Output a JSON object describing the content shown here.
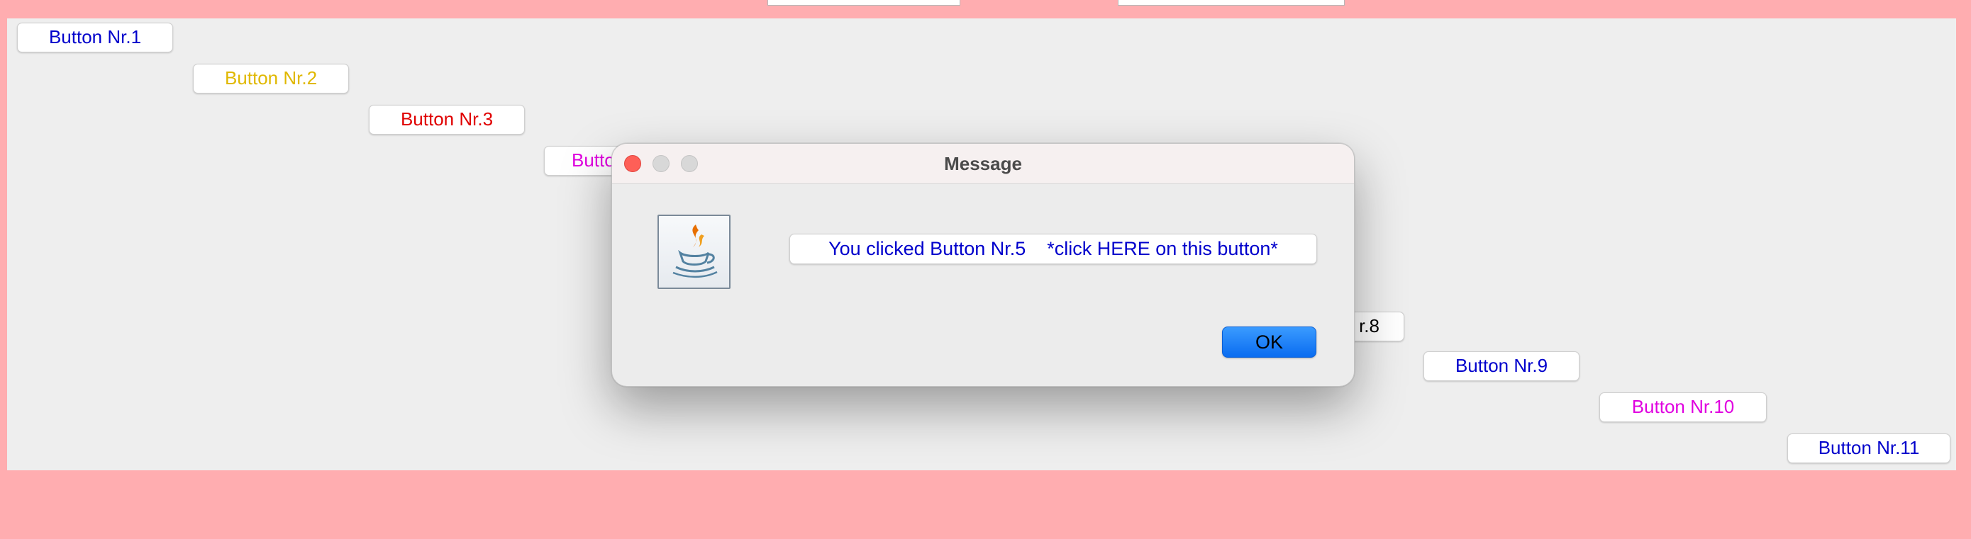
{
  "colors": {
    "background": "#ffadb0",
    "panel": "#eeeeee",
    "blue_text": "#0000cc",
    "yellow_text": "#e0b800",
    "red_text": "#e00000",
    "magenta_text": "#e000e0",
    "ok_button": "#0a6cf0"
  },
  "buttons": [
    {
      "label": "Button Nr.1",
      "color": "#0000cc"
    },
    {
      "label": "Button Nr.2",
      "color": "#e0b800"
    },
    {
      "label": "Button Nr.3",
      "color": "#e00000"
    },
    {
      "label": "Butto",
      "color": "#e000e0"
    },
    {
      "label": "r.8",
      "color": "#000000"
    },
    {
      "label": "Button Nr.9",
      "color": "#0000cc"
    },
    {
      "label": "Button Nr.10",
      "color": "#e000e0"
    },
    {
      "label": "Button Nr.11",
      "color": "#0000cc"
    }
  ],
  "dialog": {
    "title": "Message",
    "icon": "java-icon",
    "message": "You clicked Button Nr.5    *click HERE on this button*",
    "ok_label": "OK"
  }
}
